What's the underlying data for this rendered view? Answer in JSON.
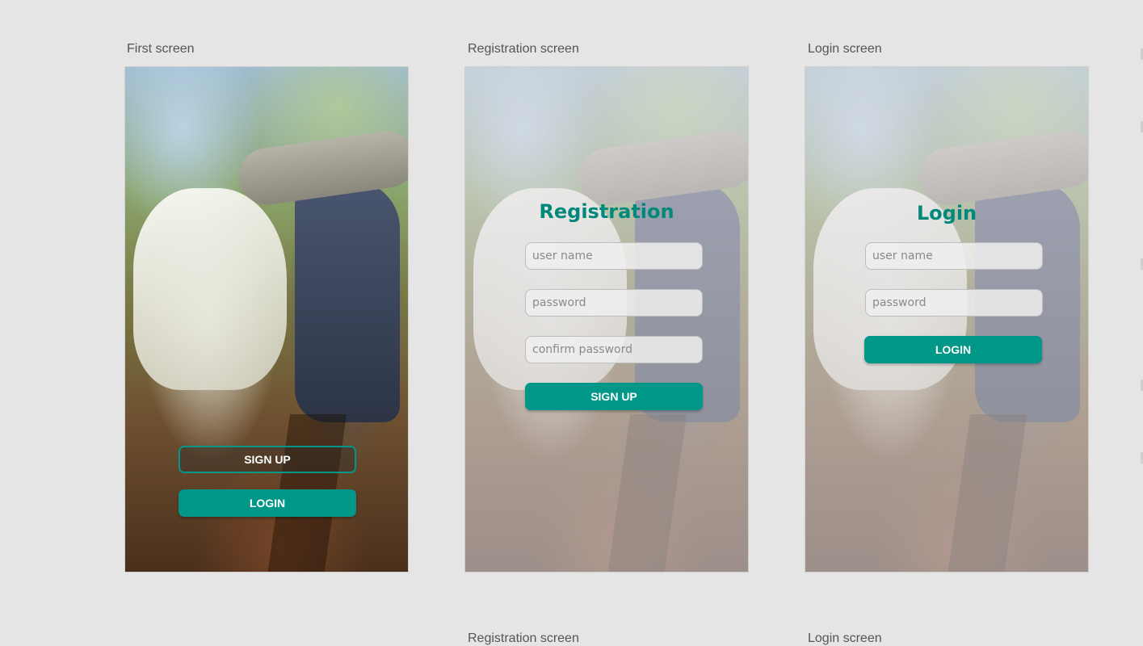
{
  "screens": [
    {
      "label": "First screen",
      "buttons": {
        "signup": "SIGN UP",
        "login": "LOGIN"
      }
    },
    {
      "label": "Registration screen",
      "heading": "Registration",
      "fields": {
        "username": "user name",
        "password": "password",
        "confirm": "confirm password"
      },
      "button": "SIGN UP"
    },
    {
      "label": "Login screen",
      "heading": "Login",
      "fields": {
        "username": "user name",
        "password": "password"
      },
      "button": "LOGIN"
    }
  ],
  "bottom_labels": [
    "Registration screen",
    "Login screen"
  ],
  "colors": {
    "accent": "#009688",
    "heading": "#00897b",
    "canvas": "#e5e5e5"
  }
}
